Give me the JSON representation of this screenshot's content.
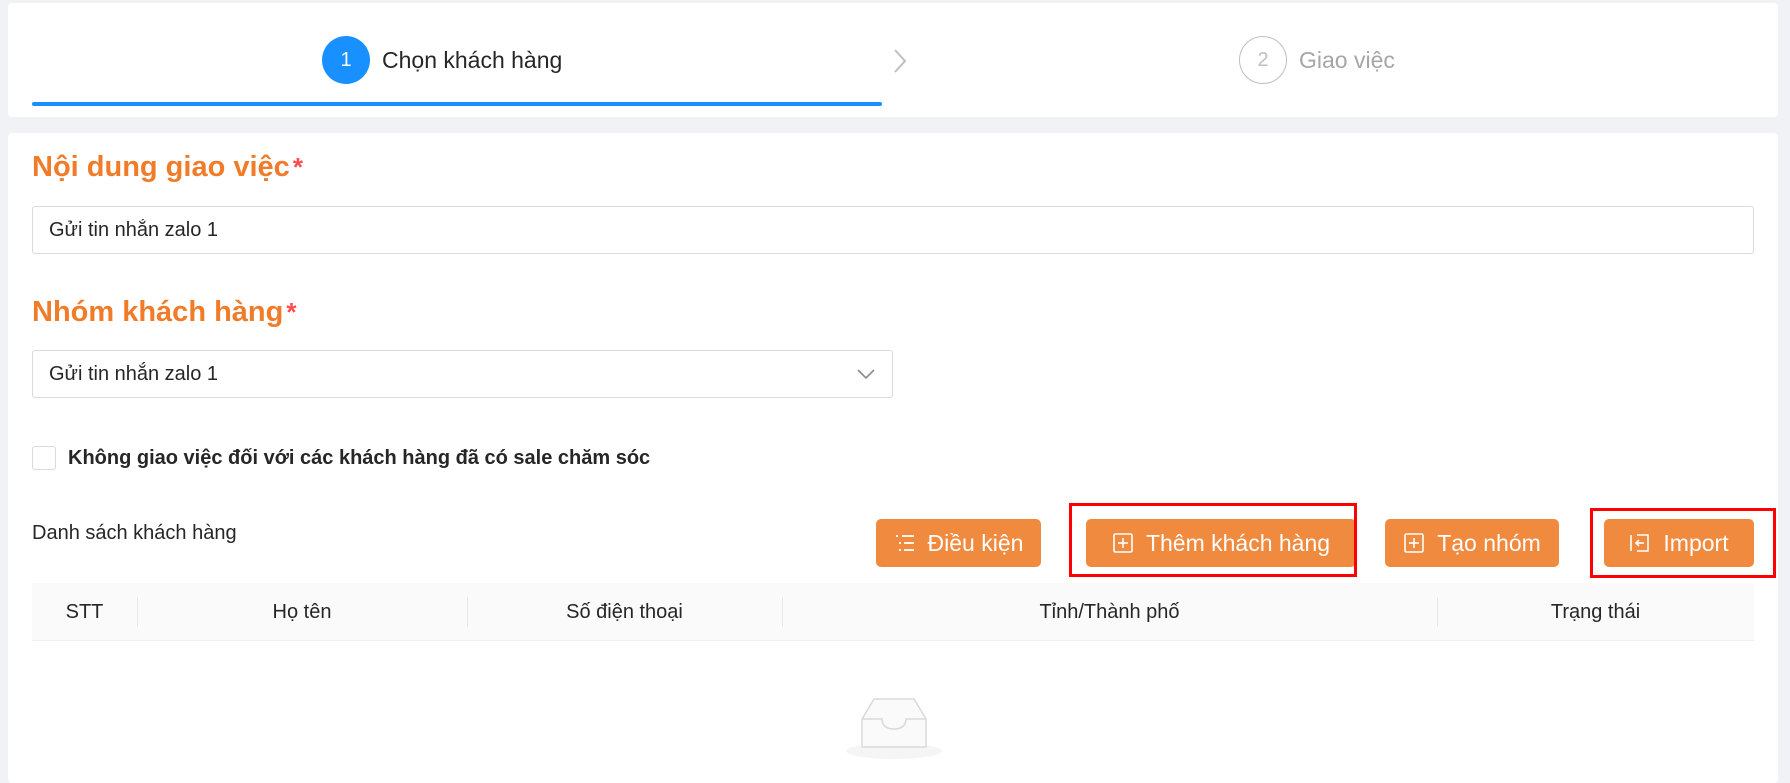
{
  "steps": [
    {
      "number": "1",
      "title": "Chọn khách hàng"
    },
    {
      "number": "2",
      "title": "Giao việc"
    }
  ],
  "form": {
    "content_label": "Nội dung giao việc",
    "content_required": "*",
    "content_value": "Gửi tin nhắn zalo 1",
    "group_label": "Nhóm khách hàng",
    "group_required": "*",
    "group_value": "Gửi tin nhắn zalo 1",
    "checkbox_label": "Không giao việc đối với các khách hàng đã có sale chăm sóc",
    "checkbox_checked": false
  },
  "list": {
    "title": "Danh sách khách hàng",
    "buttons": {
      "conditions": "Điều kiện",
      "add_customer": "Thêm khách hàng",
      "create_group": "Tạo nhóm",
      "import": "Import"
    },
    "columns": [
      "STT",
      "Họ tên",
      "Số điện thoại",
      "Tỉnh/Thành phố",
      "Trạng thái"
    ],
    "rows": []
  },
  "colors": {
    "primary": "#1890ff",
    "accent": "#f08a3e",
    "label": "#f07c2a",
    "required": "#ff4d4f",
    "highlight": "#ff0000"
  },
  "icons": {
    "step_arrow": "chevron-right-icon",
    "select_arrow": "chevron-down-icon",
    "conditions": "list-icon",
    "add_customer": "plus-square-icon",
    "create_group": "plus-square-icon",
    "import": "import-icon",
    "empty": "empty-inbox-icon"
  }
}
